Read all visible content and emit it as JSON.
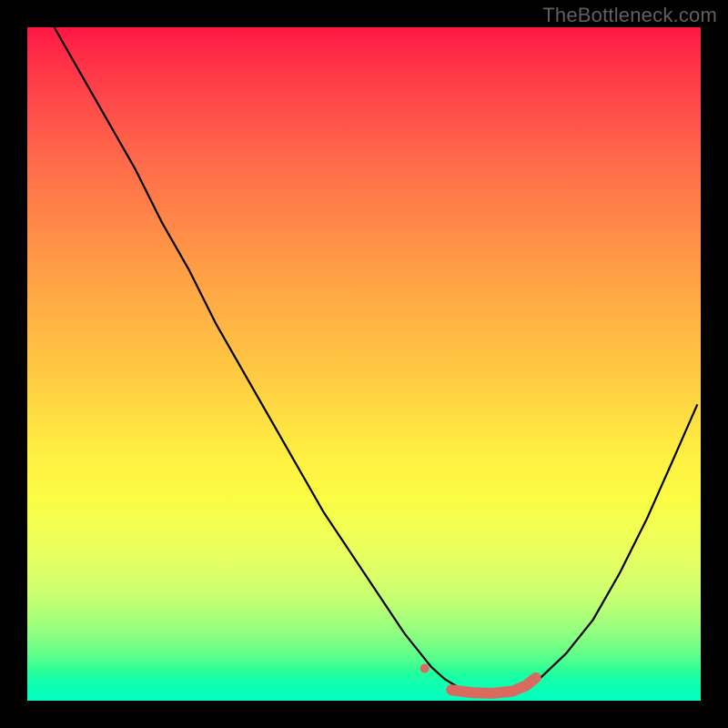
{
  "watermark": "TheBottleneck.com",
  "chart_data": {
    "type": "line",
    "title": "",
    "xlabel": "",
    "ylabel": "",
    "xlim": [
      0,
      100
    ],
    "ylim": [
      0,
      100
    ],
    "grid": false,
    "legend": false,
    "series": [
      {
        "name": "curve",
        "color": "#000000",
        "stroke_width": 2,
        "x": [
          4,
          8,
          12,
          16,
          20,
          24,
          28,
          32,
          36,
          40,
          44,
          48,
          52,
          56,
          60,
          62,
          64,
          66,
          68,
          70,
          72,
          74,
          76,
          80,
          84,
          88,
          92,
          96,
          99.5
        ],
        "y": [
          100,
          93,
          86,
          79,
          71,
          64,
          56,
          49,
          42,
          35,
          28,
          22,
          16,
          10,
          5,
          3.2,
          2.0,
          1.2,
          0.8,
          0.8,
          1.2,
          2.0,
          3.2,
          7,
          12,
          19,
          27,
          36,
          44
        ]
      },
      {
        "name": "highlight-segment",
        "color": "#d86a60",
        "stroke_width": 12,
        "linecap": "round",
        "points": [
          {
            "type": "dot",
            "x": 59,
            "y": 4.8,
            "r": 5
          },
          {
            "type": "path",
            "x": [
              63,
              66,
              69,
              72,
              74,
              75.5
            ],
            "y": [
              1.6,
              1.2,
              1.1,
              1.4,
              2.2,
              3.4
            ]
          }
        ]
      }
    ],
    "background_gradient": {
      "type": "vertical",
      "stops": [
        {
          "pos": 0.0,
          "color": "#ff1744"
        },
        {
          "pos": 0.5,
          "color": "#ffd040"
        },
        {
          "pos": 0.8,
          "color": "#e0ff60"
        },
        {
          "pos": 1.0,
          "color": "#00ffc0"
        }
      ]
    }
  }
}
